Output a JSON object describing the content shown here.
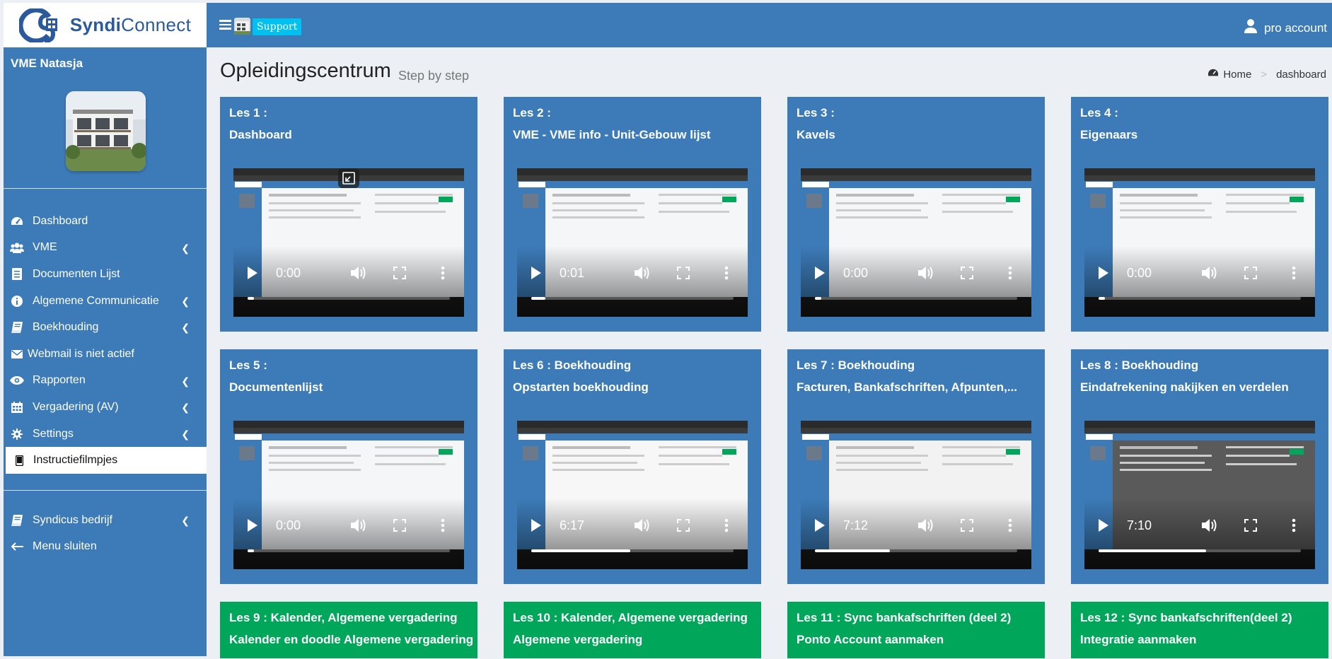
{
  "brand": {
    "name_part1": "Syndi",
    "name_part2": "Connect",
    "colors": {
      "primary": "#3c7bb8",
      "support": "#00c0ef",
      "green": "#00a65a"
    }
  },
  "sidebar": {
    "vme_name": "VME Natasja",
    "items": [
      {
        "label": "Dashboard",
        "icon": "dashboard-icon",
        "has_submenu": false
      },
      {
        "label": "VME",
        "icon": "users-icon",
        "has_submenu": true
      },
      {
        "label": "Documenten Lijst",
        "icon": "document-icon",
        "has_submenu": false
      },
      {
        "label": "Algemene Communicatie",
        "icon": "info-icon",
        "has_submenu": true
      },
      {
        "label": "Boekhouding",
        "icon": "book-icon",
        "has_submenu": true
      },
      {
        "label": "Webmail is niet actief",
        "icon": "envelope-icon",
        "has_submenu": false
      },
      {
        "label": "Rapporten",
        "icon": "eye-icon",
        "has_submenu": true
      },
      {
        "label": "Vergadering (AV)",
        "icon": "calendar-icon",
        "has_submenu": true
      },
      {
        "label": "Settings",
        "icon": "gear-icon",
        "has_submenu": true
      },
      {
        "label": "Instructiefilmpjes",
        "icon": "tablet-icon",
        "has_submenu": false,
        "active": true
      }
    ],
    "bottom_items": [
      {
        "label": "Syndicus bedrijf",
        "icon": "book-icon",
        "has_submenu": true
      },
      {
        "label": "Menu sluiten",
        "icon": "arrow-left-icon",
        "has_submenu": false
      }
    ]
  },
  "header": {
    "support_label": "Support",
    "account_label": "pro account"
  },
  "page": {
    "title": "Opleidingscentrum",
    "subtitle": "Step by step"
  },
  "breadcrumb": {
    "home": "Home",
    "current": "dashboard"
  },
  "lessons": [
    {
      "title": "Les 1 :",
      "subtitle": "Dashboard",
      "time": "0:00",
      "progress": 0.0,
      "color": "blue",
      "pip": true
    },
    {
      "title": "Les 2 :",
      "subtitle": "VME - VME info - Unit-Gebouw lijst",
      "time": "0:01",
      "progress": 0.07,
      "color": "blue"
    },
    {
      "title": "Les 3 :",
      "subtitle": "Kavels",
      "time": "0:00",
      "progress": 0.03,
      "color": "blue"
    },
    {
      "title": "Les 4 :",
      "subtitle": "Eigenaars",
      "time": "0:00",
      "progress": 0.0,
      "color": "blue"
    },
    {
      "title": "Les 5 :",
      "subtitle": "Documentenlijst",
      "time": "0:00",
      "progress": 0.03,
      "color": "blue"
    },
    {
      "title": "Les 6 : Boekhouding",
      "subtitle": "Opstarten boekhouding",
      "time": "6:17",
      "progress": 0.49,
      "color": "blue"
    },
    {
      "title": "Les 7 : Boekhouding",
      "subtitle": "Facturen, Bankafschriften, Afpunten,...",
      "time": "7:12",
      "progress": 0.37,
      "color": "blue"
    },
    {
      "title": "Les 8 : Boekhouding",
      "subtitle": "Eindafrekening nakijken en verdelen",
      "time": "7:10",
      "progress": 0.53,
      "color": "blue"
    },
    {
      "title": "Les 9 : Kalender, Algemene vergadering",
      "subtitle": "Kalender en doodle Algemene vergadering",
      "color": "green"
    },
    {
      "title": "Les 10 : Kalender, Algemene vergadering",
      "subtitle": "Algemene vergadering",
      "color": "green"
    },
    {
      "title": "Les 11 : Sync bankafschriften (deel 2)",
      "subtitle": "Ponto Account aanmaken",
      "color": "green"
    },
    {
      "title": "Les 12 : Sync bankafschriften(deel 2)",
      "subtitle": "Integratie aanmaken",
      "color": "green"
    }
  ]
}
